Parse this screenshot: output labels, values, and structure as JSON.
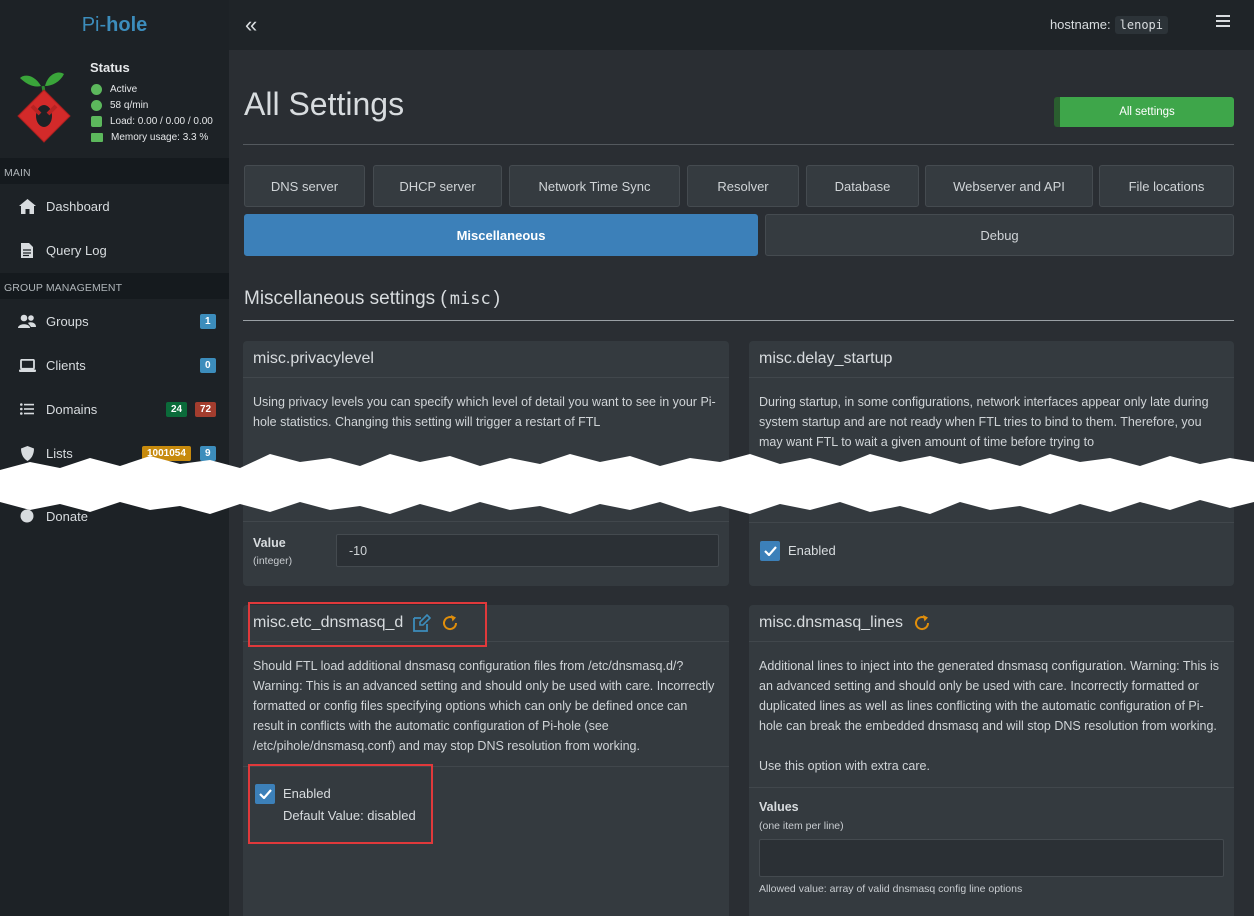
{
  "brand": {
    "prefix": "Pi-",
    "name": "hole"
  },
  "status": {
    "title": "Status",
    "active": "Active",
    "qpm": "58 q/min",
    "load": "Load:  0.00 / 0.00 / 0.00",
    "memory": "Memory usage:  3.3 %"
  },
  "nav": {
    "main_header": "MAIN",
    "group_header": "GROUP MANAGEMENT",
    "items": [
      {
        "label": "Dashboard",
        "icon": "dashboard-icon"
      },
      {
        "label": "Query Log",
        "icon": "file-icon"
      },
      {
        "label": "Groups",
        "icon": "users-icon",
        "badges": [
          "1"
        ]
      },
      {
        "label": "Clients",
        "icon": "laptop-icon",
        "badges": [
          "0"
        ]
      },
      {
        "label": "Domains",
        "icon": "list-icon",
        "badges": [
          "24",
          "72"
        ]
      },
      {
        "label": "Lists",
        "icon": "shield-icon",
        "badges": [
          "1001054",
          "9"
        ]
      },
      {
        "label": "Donate",
        "icon": "donate-icon"
      }
    ]
  },
  "topbar": {
    "collapse_icon": "«",
    "hostname_label": "hostname:",
    "hostname_value": "lenopi"
  },
  "page": {
    "title": "All Settings",
    "all_settings_btn": "All settings",
    "tabs_row1": [
      "DNS server",
      "DHCP server",
      "Network Time Sync",
      "Resolver",
      "Database",
      "Webserver and API",
      "File locations"
    ],
    "tabs_row2": [
      "Miscellaneous",
      "Debug"
    ],
    "section_title": "Miscellaneous settings (",
    "section_code": "misc",
    "section_close": ")"
  },
  "cards": {
    "privacylevel": {
      "title": "misc.privacylevel",
      "desc": "Using privacy levels you can specify which level of detail you want to see in your Pi-hole statistics. Changing this setting will trigger a restart of FTL",
      "value_label": "Value",
      "value_type": "(integer)",
      "value": "-10"
    },
    "delay_startup": {
      "title": "misc.delay_startup",
      "desc": "During startup, in some configurations, network interfaces appear only late during system startup and are not ready when FTL tries to bind to them. Therefore, you may want FTL to wait a given amount of time before trying to",
      "enabled_label": "Enabled"
    },
    "etc_dnsmasq_d": {
      "title": "misc.etc_dnsmasq_d",
      "desc": "Should FTL load additional dnsmasq configuration files from /etc/dnsmasq.d/? Warning: This is an advanced setting and should only be used with care. Incorrectly formatted or config files specifying options which can only be defined once can result in conflicts with the automatic configuration of Pi-hole (see /etc/pihole/dnsmasq.conf) and may stop DNS resolution from working.",
      "enabled_label": "Enabled",
      "default_value": "Default Value: disabled"
    },
    "dnsmasq_lines": {
      "title": "misc.dnsmasq_lines",
      "desc": "Additional lines to inject into the generated dnsmasq configuration. Warning: This is an advanced setting and should only be used with care. Incorrectly formatted or duplicated lines as well as lines conflicting with the automatic configuration of Pi-hole can break the embedded dnsmasq and will stop DNS resolution from working.",
      "desc2": "Use this option with extra care.",
      "values_label": "Values",
      "values_hint": "(one item per line)",
      "allowed": "Allowed value: array of valid dnsmasq config line options"
    }
  },
  "colors": {
    "accent": "#3c80b9",
    "success": "#3ea64a",
    "highlight": "#e0393b",
    "edit_icon": "#3c8dbc",
    "reset_icon": "#e08e0b"
  }
}
